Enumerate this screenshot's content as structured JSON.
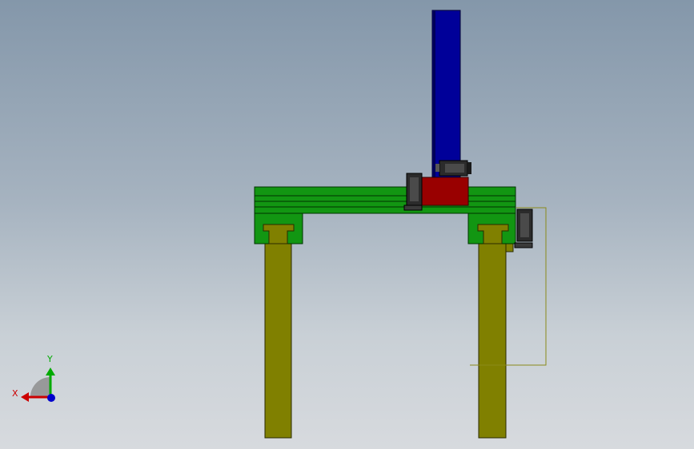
{
  "view": {
    "background_top": "#8497aa",
    "background_bottom": "#d7dade"
  },
  "model": {
    "leg_color": "#808000",
    "beam_color": "#129612",
    "column_color": "#000099",
    "carriage_color": "#990000",
    "motor_color": "#2b2b2b",
    "sketch_line_color": "#8a8a1a"
  },
  "triad": {
    "x_label": "X",
    "y_label": "Y",
    "x_color": "#cc0000",
    "y_color": "#00aa00",
    "z_color": "#0000cc"
  }
}
